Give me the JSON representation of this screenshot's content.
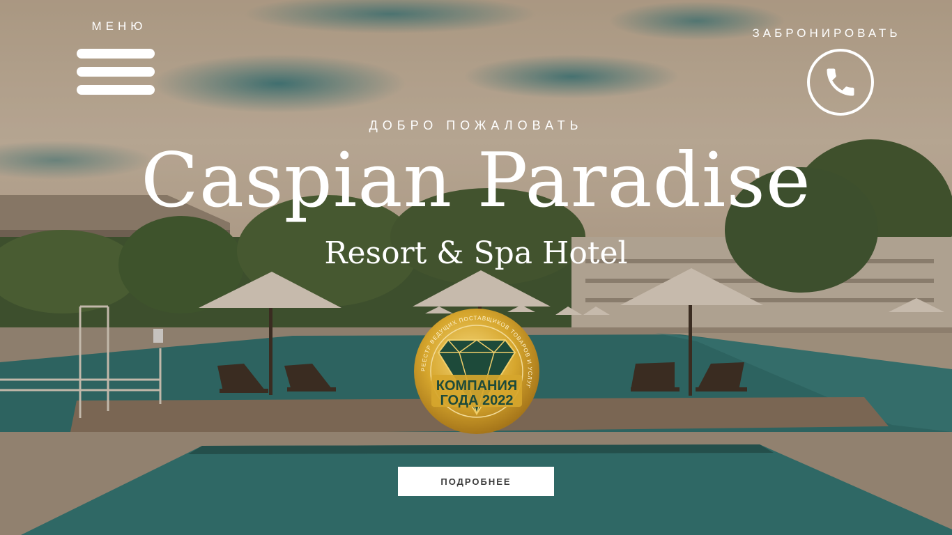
{
  "header": {
    "menu_label": "МЕНЮ",
    "book_label": "ЗАБРОНИРОВАТЬ"
  },
  "hero": {
    "welcome": "ДОБРО ПОЖАЛОВАТЬ",
    "title": "Caspian Paradise",
    "subtitle": "Resort & Spa Hotel",
    "cta_label": "ПОДРОБНЕЕ"
  },
  "badge": {
    "line1": "КОМПАНИЯ",
    "line2": "ГОДА 2022",
    "ring_text": "РЕЕСТР ВЕДУЩИХ ПОСТАВЩИКОВ ТОВАРОВ И УСЛУГ"
  },
  "icons": {
    "menu": "hamburger-icon",
    "phone": "phone-icon",
    "badge": "diamond-icon"
  },
  "colors": {
    "text": "#ffffff",
    "pool": "#1f6f70",
    "badge_gold": "#d4a72c",
    "badge_dark": "#1d4a3a"
  }
}
